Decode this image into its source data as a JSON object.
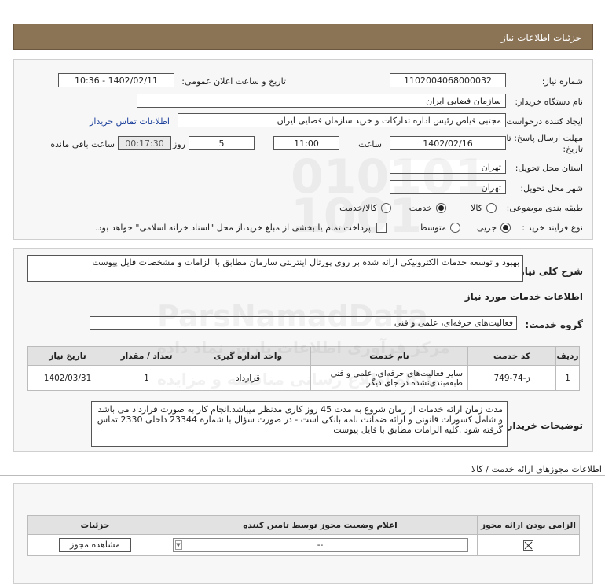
{
  "header": {
    "title": "جزئیات اطلاعات نیاز"
  },
  "fields": {
    "need_number_label": "شماره نیاز:",
    "need_number": "1102004068000032",
    "announce_label": "تاریخ و ساعت اعلان عمومی:",
    "announce_value": "1402/02/11 - 10:36",
    "buyer_org_label": "نام دستگاه خریدار:",
    "buyer_org": "سازمان فضایی ایران",
    "creator_label": "ایجاد کننده درخواست:",
    "creator": "مجتبی  فیاض رئیس اداره تدارکات و خرید سازمان فضایی ایران",
    "contact_link": "اطلاعات تماس خریدار",
    "deadline_label_1": "مهلت ارسال پاسخ: تا",
    "deadline_label_2": "تاریخ:",
    "deadline_date": "1402/02/16",
    "time_label": "ساعت",
    "deadline_time": "11:00",
    "days": "5",
    "days_label": "روز و",
    "remaining": "00:17:30",
    "remaining_label": "ساعت باقی مانده",
    "province_label": "استان محل تحویل:",
    "province": "تهران",
    "city_label": "شهر محل تحویل:",
    "city": "تهران",
    "category_label": "طبقه بندی موضوعی:",
    "category_options": [
      "کالا",
      "خدمت",
      "کالا/خدمت"
    ],
    "category_selected": "خدمت",
    "process_label": "نوع فرآیند خرید :",
    "process_options": [
      "جزیی",
      "متوسط"
    ],
    "process_selected": "جزیی",
    "payment_note": "پرداخت تمام یا بخشی از مبلغ خرید،از محل \"اسناد خزانه اسلامی\" خواهد بود."
  },
  "summary": {
    "label": "شرح کلی نیاز:",
    "text": "بهبود و توسعه خدمات الکترونیکی ارائه شده بر روی پورتال اینترنتی سازمان مطابق با الزامات و مشخصات فایل پیوست"
  },
  "services": {
    "section_title": "اطلاعات خدمات مورد نیاز",
    "group_label": "گروه خدمت:",
    "group_value": "فعالیت‌های حرفه‌ای، علمی و فنی",
    "columns": [
      "ردیف",
      "کد خدمت",
      "نام خدمت",
      "واحد اندازه گیری",
      "تعداد / مقدار",
      "تاریخ نیاز"
    ],
    "rows": [
      [
        "1",
        "ز-74-749",
        "سایر فعالیت‌های حرفه‌ای، علمی و فنی طبقه‌بندی‌نشده در جای دیگر",
        "قرارداد",
        "1",
        "1402/03/31"
      ]
    ]
  },
  "buyer_notes": {
    "label": "توضیحات خریدار:",
    "text": "مدت زمان ارائه خدمات از زمان شروع به مدت 45 روز کاری مدنظر میباشد.انجام کار به صورت قرارداد می باشد و شامل کسورات قانونی و ارائه ضمانت نامه بانکی است - در صورت سؤال با شماره 23344 داخلی 2330 تماس گرفته شود .کلیه الزامات مطابق با فایل پیوست"
  },
  "licenses": {
    "section_title": "اطلاعات مجوزهای ارائه خدمت / کالا",
    "columns": [
      "الزامی بودن ارائه مجوز",
      "اعلام وضعیت مجوز توسط تامین کننده",
      "جزئیات"
    ],
    "select_value": "--",
    "view_button": "مشاهده مجوز"
  },
  "watermark": {
    "line1": "ParsNamadData",
    "line2": "مرکز فرآوری اطلاعات پارس نماد داده",
    "line3": "پایگاه اطلاع رسانی مناقصه و مزایده"
  },
  "colors": {
    "header_bg": "#8b7355",
    "link": "#1a3e9a",
    "panel_bg": "#f7f7f7"
  }
}
